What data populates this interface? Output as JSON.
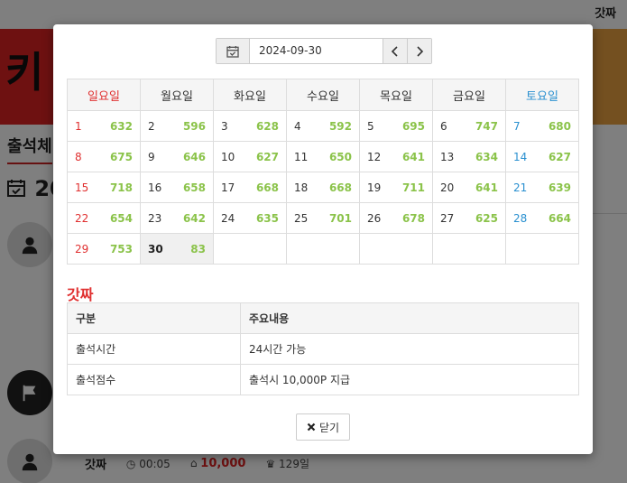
{
  "background": {
    "top_label": "갓짜",
    "banner_glyph": "키",
    "tab_label": "출석체",
    "calendar_prefix": "20",
    "entry": {
      "name": "갓짜",
      "time": "00:05",
      "points": "10,000",
      "days": "129일"
    }
  },
  "date_picker": {
    "value": "2024-09-30",
    "prev_label": "‹",
    "next_label": "›"
  },
  "calendar": {
    "weekdays": [
      "일요일",
      "월요일",
      "화요일",
      "수요일",
      "목요일",
      "금요일",
      "토요일"
    ],
    "weeks": [
      [
        {
          "d": "1",
          "c": "632"
        },
        {
          "d": "2",
          "c": "596"
        },
        {
          "d": "3",
          "c": "628"
        },
        {
          "d": "4",
          "c": "592"
        },
        {
          "d": "5",
          "c": "695"
        },
        {
          "d": "6",
          "c": "747"
        },
        {
          "d": "7",
          "c": "680"
        }
      ],
      [
        {
          "d": "8",
          "c": "675"
        },
        {
          "d": "9",
          "c": "646"
        },
        {
          "d": "10",
          "c": "627"
        },
        {
          "d": "11",
          "c": "650"
        },
        {
          "d": "12",
          "c": "641"
        },
        {
          "d": "13",
          "c": "634"
        },
        {
          "d": "14",
          "c": "627"
        }
      ],
      [
        {
          "d": "15",
          "c": "718"
        },
        {
          "d": "16",
          "c": "658"
        },
        {
          "d": "17",
          "c": "668"
        },
        {
          "d": "18",
          "c": "668"
        },
        {
          "d": "19",
          "c": "711"
        },
        {
          "d": "20",
          "c": "641"
        },
        {
          "d": "21",
          "c": "639"
        }
      ],
      [
        {
          "d": "22",
          "c": "654"
        },
        {
          "d": "23",
          "c": "642"
        },
        {
          "d": "24",
          "c": "635"
        },
        {
          "d": "25",
          "c": "701"
        },
        {
          "d": "26",
          "c": "678"
        },
        {
          "d": "27",
          "c": "625"
        },
        {
          "d": "28",
          "c": "664"
        }
      ],
      [
        {
          "d": "29",
          "c": "753"
        },
        {
          "d": "30",
          "c": "83"
        },
        {
          "d": "",
          "c": ""
        },
        {
          "d": "",
          "c": ""
        },
        {
          "d": "",
          "c": ""
        },
        {
          "d": "",
          "c": ""
        },
        {
          "d": "",
          "c": ""
        }
      ]
    ]
  },
  "info": {
    "title": "갓짜",
    "headers": [
      "구분",
      "주요내용"
    ],
    "rows": [
      [
        "출석시간",
        "24시간 가능"
      ],
      [
        "출석점수",
        "출석시 10,000P 지급"
      ]
    ]
  },
  "close_label": "닫기",
  "colors": {
    "sunday": "#e03030",
    "saturday": "#2a90d0",
    "count": "#8bc34a"
  }
}
